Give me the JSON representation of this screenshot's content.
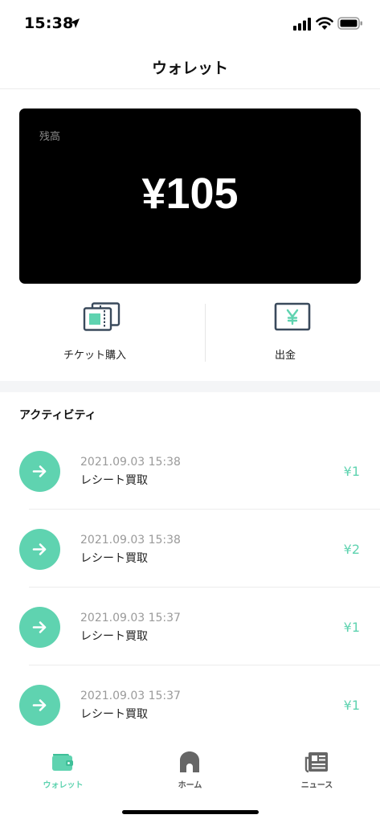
{
  "status_bar": {
    "time": "15:38"
  },
  "nav": {
    "title": "ウォレット"
  },
  "balance": {
    "label": "残高",
    "amount": "¥105"
  },
  "actions": [
    {
      "label": "チケット購入",
      "icon": "ticket-icon"
    },
    {
      "label": "出金",
      "icon": "yen-withdraw-icon"
    }
  ],
  "activity": {
    "title": "アクティビティ",
    "items": [
      {
        "date": "2021.09.03 15:38",
        "description": "レシート買取",
        "amount": "¥1"
      },
      {
        "date": "2021.09.03 15:38",
        "description": "レシート買取",
        "amount": "¥2"
      },
      {
        "date": "2021.09.03 15:37",
        "description": "レシート買取",
        "amount": "¥1"
      },
      {
        "date": "2021.09.03 15:37",
        "description": "レシート買取",
        "amount": "¥1"
      }
    ]
  },
  "tabs": [
    {
      "label": "ウォレット",
      "icon": "wallet-icon",
      "active": true
    },
    {
      "label": "ホーム",
      "icon": "home-icon",
      "active": false
    },
    {
      "label": "ニュース",
      "icon": "news-icon",
      "active": false
    }
  ],
  "colors": {
    "accent": "#5fd3b0",
    "card_bg": "#000000",
    "section_bg": "#f4f5f7"
  }
}
